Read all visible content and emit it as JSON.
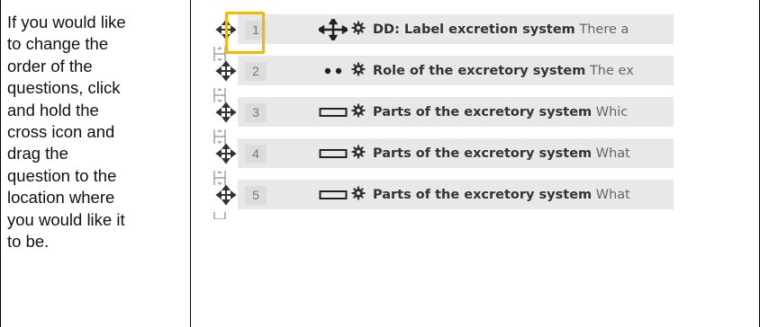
{
  "instruction": {
    "lines": [
      "If you would like",
      "to change the",
      "order of the",
      "questions, click",
      "and hold the",
      "cross icon and",
      "drag the",
      "question to the",
      "location where",
      "you would like it",
      "to be."
    ]
  },
  "questions": [
    {
      "number": "1",
      "type_icon": "move-cross-icon",
      "title": "DD: Label excretion system",
      "desc": "There a"
    },
    {
      "number": "2",
      "type_icon": "two-dots-icon",
      "title": "Role of the excretory system",
      "desc": "The ex"
    },
    {
      "number": "3",
      "type_icon": "textbox-icon",
      "title": "Parts of the excretory system",
      "desc": "Whic"
    },
    {
      "number": "4",
      "type_icon": "textbox-icon",
      "title": "Parts of the excretory system",
      "desc": "What"
    },
    {
      "number": "5",
      "type_icon": "textbox-icon",
      "title": "Parts of the excretory system",
      "desc": "What"
    }
  ],
  "colors": {
    "highlight": "#f5b800",
    "row_background": "#e8e8e8"
  }
}
